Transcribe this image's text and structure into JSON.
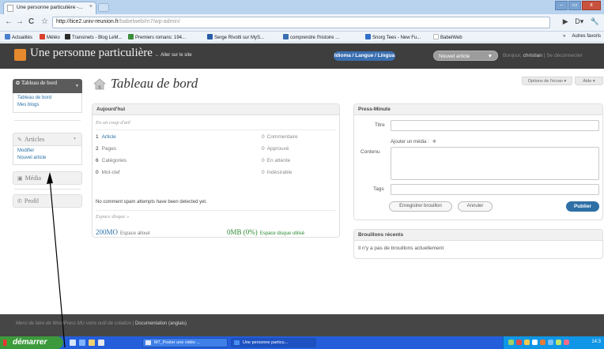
{
  "browser": {
    "tab_title": "Une personne particulière -...",
    "tab_close": "×",
    "url_host": "http://tice2.univ-reunion.fr",
    "url_path": "/babelweb/m7/wp-admin/",
    "nav": {
      "back": "←",
      "forward": "→",
      "reload": "C",
      "star": "☆"
    },
    "window_controls": [
      "–",
      "▭",
      "x"
    ],
    "toolbar_right": [
      "▶",
      "D▾",
      "🔧"
    ],
    "bookmarks": [
      {
        "label": "Actualités",
        "color": "#4a7fcb"
      },
      {
        "label": "Météo",
        "color": "#d9412f"
      },
      {
        "label": "Transinets - Blog LeM...",
        "color": "#2a2a2a"
      },
      {
        "label": "Premiers romans: 194...",
        "color": "#3a8c3a"
      },
      {
        "label": "Serge Rivotti sur MyS...",
        "color": "#2a5aa8"
      },
      {
        "label": "comprendre l'histoire ...",
        "color": "#3a6fb0"
      },
      {
        "label": "Snorg Tees - New Fu...",
        "color": "#2f6fc9"
      },
      {
        "label": "BabelWeb",
        "color": "#bbbbbb"
      }
    ],
    "bookmarks_more": "»",
    "other_bookmarks": "Autres favoris"
  },
  "header": {
    "site_title": "Une personne particulière",
    "visit_site": "← Aller sur le site",
    "lang_pill": "Idioma / Langue / Lingua",
    "new_article": "Nouvel article",
    "new_article_arrow": "▼",
    "howdy": "Bonjour,",
    "username": "christian",
    "logout_sep": "|",
    "logout": "Se déconnecter"
  },
  "sidebar": {
    "dashboard": "Tableau de bord",
    "dashboard_sub": [
      "Tableau de bord",
      "Mes blogs"
    ],
    "articles": "Articles",
    "articles_sub": [
      "Modifier",
      "Nouvel article"
    ],
    "media": "Média",
    "profile": "Profil",
    "collapse": "▼"
  },
  "main": {
    "title": "Tableau de bord",
    "screen_options": "Options de l'écran ▾",
    "help": "Aide ▾"
  },
  "right_now": {
    "heading": "Aujourd'hui",
    "glance": "En un coup d'œil",
    "left": [
      {
        "num": "1",
        "label": "Article"
      },
      {
        "num": "2",
        "label": "Pages"
      },
      {
        "num": "6",
        "label": "Catégories"
      },
      {
        "num": "0",
        "label": "Mot-clef"
      }
    ],
    "right": [
      {
        "num": "0",
        "label": "Commentaire"
      },
      {
        "num": "0",
        "label": "Approuvé"
      },
      {
        "num": "0",
        "label": "En attente"
      },
      {
        "num": "0",
        "label": "Indésirable"
      }
    ],
    "spam_text": "No comment spam attempts have been detected yet.",
    "disk_title": "Espace disque »",
    "disk_allocated_value": "200MO",
    "disk_allocated_label": "Espace alloué",
    "disk_used_value": "0MB (0%)",
    "disk_used_label": "Espace disque utilisé"
  },
  "press": {
    "heading": "Press-Minute",
    "title_label": "Titre",
    "media_label": "Ajouter un média :",
    "media_icon": "❋",
    "content_label": "Contenu",
    "tags_label": "Tags",
    "save_draft": "Enregistrer brouillon",
    "cancel": "Annuler",
    "publish": "Publier"
  },
  "drafts": {
    "heading": "Brouillons récents",
    "empty": "Il n'y a pas de brouillons actuellement"
  },
  "footer": {
    "text": "Merci de faire de WordPress MU votre outil de création |",
    "doc_link": "Documentation (anglais)"
  },
  "taskbar": {
    "start": "démarrer",
    "tasks": [
      "M7_Poster une vidéo ...",
      "Une personne particu..."
    ],
    "clock": "14:3"
  }
}
